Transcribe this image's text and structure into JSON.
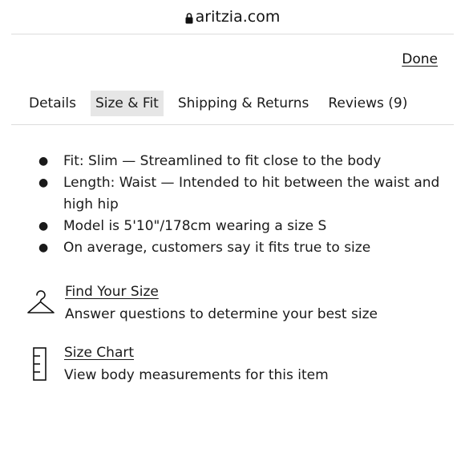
{
  "browser": {
    "url": "aritzia.com",
    "lock_icon": "lock-icon"
  },
  "header": {
    "done_label": "Done"
  },
  "tabs": [
    {
      "label": "Details",
      "active": false
    },
    {
      "label": "Size & Fit",
      "active": true
    },
    {
      "label": "Shipping & Returns",
      "active": false
    },
    {
      "label": "Reviews (9)",
      "active": false
    }
  ],
  "fit_details": [
    "Fit: Slim — Streamlined to fit close to the body",
    "Length: Waist — Intended to hit between the waist and high hip",
    "Model is 5'10\"/178cm wearing a size S",
    "On average, customers say it fits true to size"
  ],
  "tools": {
    "find_size": {
      "icon": "hanger-icon",
      "title": "Find Your Size",
      "description": "Answer questions to determine your best size"
    },
    "size_chart": {
      "icon": "ruler-icon",
      "title": "Size Chart",
      "description": "View body measurements for this item"
    }
  },
  "colors": {
    "active_tab_bg": "#e6e6e6",
    "divider": "#dcdcdc",
    "text": "#1a1a1a"
  }
}
